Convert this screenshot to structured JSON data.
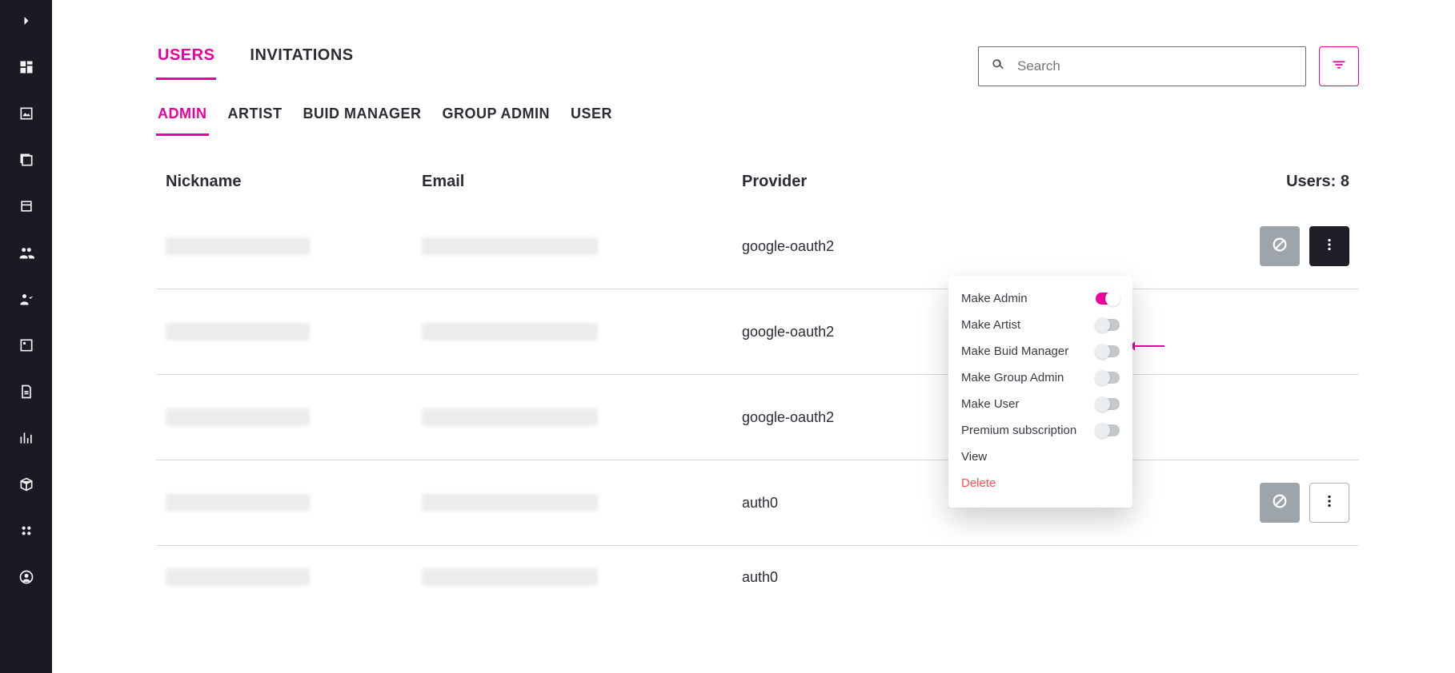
{
  "tabs_primary": [
    {
      "label": "USERS",
      "active": true
    },
    {
      "label": "INVITATIONS",
      "active": false
    }
  ],
  "search": {
    "placeholder": "Search"
  },
  "tabs_secondary": [
    {
      "label": "ADMIN",
      "active": true
    },
    {
      "label": "ARTIST",
      "active": false
    },
    {
      "label": "BUID MANAGER",
      "active": false
    },
    {
      "label": "GROUP ADMIN",
      "active": false
    },
    {
      "label": "USER",
      "active": false
    }
  ],
  "columns": {
    "nickname": "Nickname",
    "email": "Email",
    "provider": "Provider",
    "users_count": "Users: 8"
  },
  "rows": [
    {
      "provider": "google-oauth2",
      "menu_open": true,
      "more_style": "dark"
    },
    {
      "provider": "google-oauth2"
    },
    {
      "provider": "google-oauth2"
    },
    {
      "provider": "auth0",
      "more_style": "outline"
    },
    {
      "provider": "auth0"
    }
  ],
  "menu": {
    "options": [
      {
        "label": "Make Admin",
        "on": true
      },
      {
        "label": "Make Artist",
        "on": false
      },
      {
        "label": "Make Buid Manager",
        "on": false
      },
      {
        "label": "Make Group Admin",
        "on": false
      },
      {
        "label": "Make User",
        "on": false
      },
      {
        "label": "Premium subscription",
        "on": false
      }
    ],
    "view": "View",
    "delete": "Delete"
  }
}
